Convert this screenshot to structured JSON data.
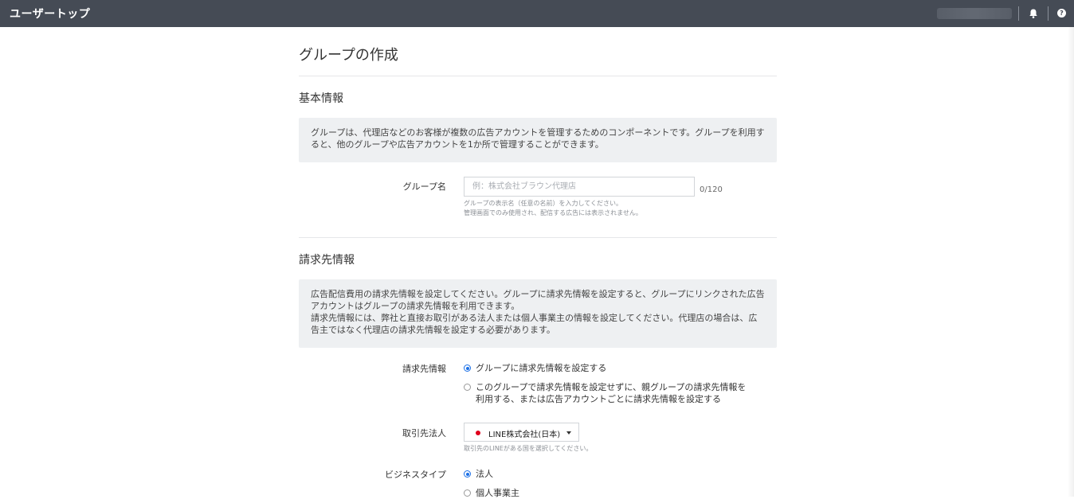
{
  "header": {
    "title": "ユーザートップ",
    "icons": [
      "bell-icon",
      "help-icon"
    ],
    "help_glyph": "?"
  },
  "page": {
    "title": "グループの作成"
  },
  "basic_info": {
    "title": "基本情報",
    "description": "グループは、代理店などのお客様が複数の広告アカウントを管理するためのコンポーネントです。グループを利用すると、他のグループや広告アカウントを1か所で管理することができます。",
    "group_name": {
      "label": "グループ名",
      "placeholder": "例：株式会社ブラウン代理店",
      "value": "",
      "counter": "0/120",
      "help_line1": "グループの表示名（任意の名前）を入力してください。",
      "help_line2": "管理画面でのみ使用され、配信する広告には表示されません。"
    }
  },
  "billing_info": {
    "title": "請求先情報",
    "description_line1": "広告配信費用の請求先情報を設定してください。グループに請求先情報を設定すると、グループにリンクされた広告アカウントはグループの請求先情報を利用できます。",
    "description_line2": "請求先情報には、弊社と直接お取引がある法人または個人事業主の情報を設定してください。代理店の場合は、広告主ではなく代理店の請求先情報を設定する必要があります。",
    "billing": {
      "label": "請求先情報",
      "options": [
        {
          "text": "グループに請求先情報を設定する",
          "checked": true
        },
        {
          "text_line1": "このグループで請求先情報を設定せずに、親グループの請求先情報を",
          "text_line2": "利用する、または広告アカウントごとに請求先情報を設定する",
          "checked": false
        }
      ]
    },
    "entity": {
      "label": "取引先法人",
      "selected": "LINE株式会社(日本)",
      "help": "取引先のLINEがある国を選択してください。"
    },
    "business_type": {
      "label": "ビジネスタイプ",
      "options": [
        {
          "text": "法人",
          "checked": true
        },
        {
          "text": "個人事業主",
          "checked": false
        }
      ]
    }
  },
  "colors": {
    "header_bg": "#454b55",
    "info_bg": "#eef0f2",
    "accent": "#1a6fe6",
    "line_red": "#e0001b"
  }
}
